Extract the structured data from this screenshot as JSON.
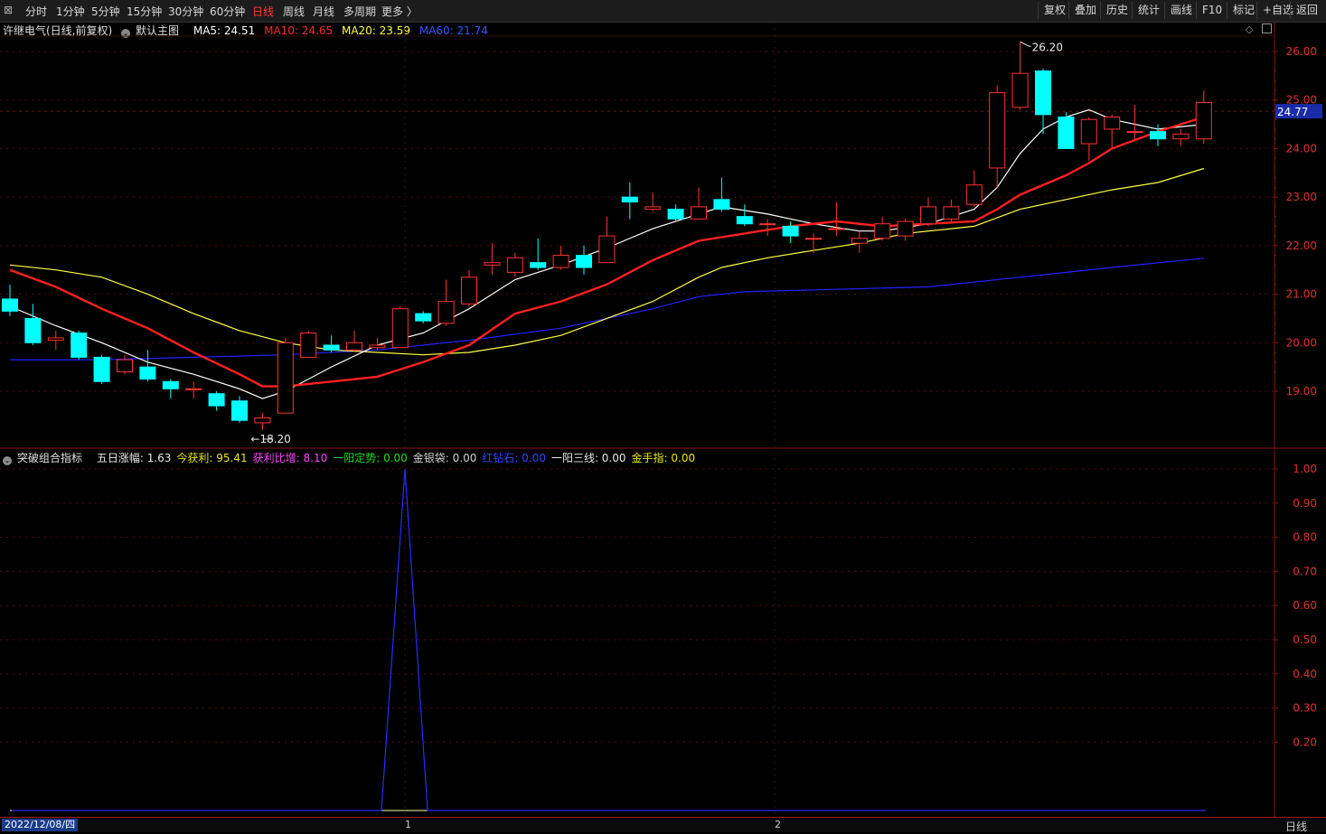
{
  "toolbar": {
    "periods": [
      "分时",
      "1分钟",
      "5分钟",
      "15分钟",
      "30分钟",
      "60分钟",
      "日线",
      "周线",
      "月线",
      "多周期",
      "更多 〉"
    ],
    "active_period": "日线",
    "right_buttons": [
      "复权",
      "叠加",
      "历史",
      "统计",
      "画线",
      "F10",
      "标记",
      "+自选",
      "返回"
    ]
  },
  "main_legend": {
    "stock": "许继电气(日线,前复权)",
    "template": "默认主图",
    "ma5": "MA5: 24.51",
    "ma10": "MA10: 24.65",
    "ma20": "MA20: 23.59",
    "ma60": "MA60: 21.74"
  },
  "sub_legend": {
    "name": "突破组合指标",
    "items": [
      {
        "label": "五日涨幅: 1.63",
        "color": "#e8e8e8"
      },
      {
        "label": "今获利: 95.41",
        "color": "#e8e800"
      },
      {
        "label": "获利比增: 8.10",
        "color": "#ff44ff"
      },
      {
        "label": "一阳定势: 0.00",
        "color": "#22dd22"
      },
      {
        "label": "金银袋: 0.00",
        "color": "#cfcfcf"
      },
      {
        "label": "红钻石: 0.00",
        "color": "#3344ff"
      },
      {
        "label": "一阳三线: 0.00",
        "color": "#e8e8e8"
      },
      {
        "label": "金手指: 0.00",
        "color": "#e8e800"
      }
    ]
  },
  "bottom": {
    "date": "2022/12/08/四",
    "marker1": "1",
    "marker2": "2",
    "period": "日线"
  },
  "colors": {
    "up": "#ff3232",
    "down": "#00ffff",
    "ma5": "#ffffff",
    "ma10": "#ff2020",
    "ma20": "#ffff44",
    "ma60": "#2222ff",
    "signal": "#2a2aff"
  },
  "chart_data": [
    {
      "type": "candlestick",
      "title": "许继电气(日线,前复权)",
      "y_ticks": [
        "26.00",
        "25.00",
        "24.00",
        "23.00",
        "22.00",
        "21.00",
        "20.00",
        "19.00"
      ],
      "ylim": [
        18.2,
        26.8
      ],
      "current_price": "24.77",
      "max_label": "26.20",
      "min_label": "18.20",
      "candles": [
        {
          "o": 20.9,
          "c": 20.65,
          "h": 21.2,
          "l": 20.55
        },
        {
          "o": 20.5,
          "c": 20.0,
          "h": 20.8,
          "l": 19.95
        },
        {
          "o": 20.05,
          "c": 20.1,
          "h": 20.25,
          "l": 19.85
        },
        {
          "o": 20.2,
          "c": 19.7,
          "h": 20.25,
          "l": 19.65
        },
        {
          "o": 19.7,
          "c": 19.2,
          "h": 19.75,
          "l": 19.15
        },
        {
          "o": 19.4,
          "c": 19.65,
          "h": 19.75,
          "l": 19.35
        },
        {
          "o": 19.5,
          "c": 19.25,
          "h": 19.85,
          "l": 19.2
        },
        {
          "o": 19.2,
          "c": 19.05,
          "h": 19.25,
          "l": 18.85
        },
        {
          "o": 19.05,
          "c": 19.05,
          "h": 19.2,
          "l": 18.85
        },
        {
          "o": 18.95,
          "c": 18.7,
          "h": 19.0,
          "l": 18.6
        },
        {
          "o": 18.8,
          "c": 18.4,
          "h": 18.9,
          "l": 18.35
        },
        {
          "o": 18.35,
          "c": 18.45,
          "h": 18.55,
          "l": 18.2
        },
        {
          "o": 18.55,
          "c": 20.0,
          "h": 20.1,
          "l": 18.55
        },
        {
          "o": 19.7,
          "c": 20.2,
          "h": 20.25,
          "l": 19.7
        },
        {
          "o": 19.95,
          "c": 19.85,
          "h": 20.15,
          "l": 19.8
        },
        {
          "o": 19.85,
          "c": 20.0,
          "h": 20.25,
          "l": 19.8
        },
        {
          "o": 19.9,
          "c": 19.95,
          "h": 20.1,
          "l": 19.85
        },
        {
          "o": 19.9,
          "c": 20.7,
          "h": 20.75,
          "l": 19.9
        },
        {
          "o": 20.6,
          "c": 20.45,
          "h": 20.65,
          "l": 20.4
        },
        {
          "o": 20.4,
          "c": 20.85,
          "h": 21.3,
          "l": 20.35
        },
        {
          "o": 20.8,
          "c": 21.35,
          "h": 21.5,
          "l": 20.75
        },
        {
          "o": 21.6,
          "c": 21.65,
          "h": 22.05,
          "l": 21.4
        },
        {
          "o": 21.45,
          "c": 21.75,
          "h": 21.85,
          "l": 21.35
        },
        {
          "o": 21.65,
          "c": 21.55,
          "h": 22.15,
          "l": 21.5
        },
        {
          "o": 21.55,
          "c": 21.8,
          "h": 22.0,
          "l": 21.5
        },
        {
          "o": 21.8,
          "c": 21.55,
          "h": 22.0,
          "l": 21.4
        },
        {
          "o": 21.65,
          "c": 22.2,
          "h": 22.6,
          "l": 21.65
        },
        {
          "o": 23.0,
          "c": 22.9,
          "h": 23.3,
          "l": 22.55
        },
        {
          "o": 22.75,
          "c": 22.8,
          "h": 23.1,
          "l": 22.7
        },
        {
          "o": 22.75,
          "c": 22.55,
          "h": 22.85,
          "l": 22.5
        },
        {
          "o": 22.55,
          "c": 22.8,
          "h": 23.2,
          "l": 22.55
        },
        {
          "o": 22.95,
          "c": 22.75,
          "h": 23.4,
          "l": 22.7
        },
        {
          "o": 22.6,
          "c": 22.45,
          "h": 22.85,
          "l": 22.4
        },
        {
          "o": 22.45,
          "c": 22.45,
          "h": 22.55,
          "l": 22.2
        },
        {
          "o": 22.4,
          "c": 22.2,
          "h": 22.5,
          "l": 22.05
        },
        {
          "o": 22.15,
          "c": 22.15,
          "h": 22.25,
          "l": 21.85
        },
        {
          "o": 22.35,
          "c": 22.35,
          "h": 22.9,
          "l": 22.2
        },
        {
          "o": 22.05,
          "c": 22.15,
          "h": 22.3,
          "l": 21.85
        },
        {
          "o": 22.15,
          "c": 22.45,
          "h": 22.6,
          "l": 22.1
        },
        {
          "o": 22.2,
          "c": 22.5,
          "h": 22.55,
          "l": 22.1
        },
        {
          "o": 22.45,
          "c": 22.8,
          "h": 23.0,
          "l": 22.4
        },
        {
          "o": 22.55,
          "c": 22.8,
          "h": 22.95,
          "l": 22.5
        },
        {
          "o": 22.85,
          "c": 23.25,
          "h": 23.55,
          "l": 22.8
        },
        {
          "o": 23.6,
          "c": 25.15,
          "h": 25.3,
          "l": 23.2
        },
        {
          "o": 24.85,
          "c": 25.55,
          "h": 26.2,
          "l": 24.8
        },
        {
          "o": 25.6,
          "c": 24.7,
          "h": 25.65,
          "l": 24.3
        },
        {
          "o": 24.65,
          "c": 24.0,
          "h": 24.75,
          "l": 24.0
        },
        {
          "o": 24.1,
          "c": 24.6,
          "h": 24.65,
          "l": 23.75
        },
        {
          "o": 24.4,
          "c": 24.65,
          "h": 24.7,
          "l": 24.0
        },
        {
          "o": 24.35,
          "c": 24.35,
          "h": 24.9,
          "l": 24.2
        },
        {
          "o": 24.35,
          "c": 24.2,
          "h": 24.5,
          "l": 24.05
        },
        {
          "o": 24.2,
          "c": 24.3,
          "h": 24.4,
          "l": 24.05
        },
        {
          "o": 24.2,
          "c": 24.95,
          "h": 25.2,
          "l": 24.1
        }
      ],
      "ma5": [
        [
          0,
          20.75
        ],
        [
          2,
          20.35
        ],
        [
          4,
          20.0
        ],
        [
          6,
          19.6
        ],
        [
          8,
          19.35
        ],
        [
          10,
          19.05
        ],
        [
          11,
          18.85
        ],
        [
          12,
          19.0
        ],
        [
          14,
          19.5
        ],
        [
          16,
          19.95
        ],
        [
          18,
          20.2
        ],
        [
          20,
          20.7
        ],
        [
          22,
          21.3
        ],
        [
          24,
          21.6
        ],
        [
          26,
          21.95
        ],
        [
          28,
          22.35
        ],
        [
          30,
          22.65
        ],
        [
          31,
          22.8
        ],
        [
          33,
          22.65
        ],
        [
          35,
          22.45
        ],
        [
          37,
          22.3
        ],
        [
          38,
          22.3
        ],
        [
          40,
          22.45
        ],
        [
          42,
          22.75
        ],
        [
          43,
          23.2
        ],
        [
          44,
          23.9
        ],
        [
          45,
          24.4
        ],
        [
          46,
          24.65
        ],
        [
          47,
          24.8
        ],
        [
          48,
          24.6
        ],
        [
          50,
          24.4
        ],
        [
          52,
          24.5
        ]
      ],
      "ma10": [
        [
          0,
          21.5
        ],
        [
          2,
          21.15
        ],
        [
          4,
          20.7
        ],
        [
          6,
          20.3
        ],
        [
          8,
          19.8
        ],
        [
          10,
          19.35
        ],
        [
          11,
          19.1
        ],
        [
          12,
          19.1
        ],
        [
          14,
          19.2
        ],
        [
          16,
          19.3
        ],
        [
          18,
          19.6
        ],
        [
          20,
          19.95
        ],
        [
          22,
          20.6
        ],
        [
          24,
          20.85
        ],
        [
          26,
          21.2
        ],
        [
          28,
          21.7
        ],
        [
          30,
          22.1
        ],
        [
          32,
          22.25
        ],
        [
          34,
          22.4
        ],
        [
          36,
          22.5
        ],
        [
          38,
          22.4
        ],
        [
          40,
          22.45
        ],
        [
          42,
          22.5
        ],
        [
          43,
          22.75
        ],
        [
          44,
          23.05
        ],
        [
          46,
          23.45
        ],
        [
          47,
          23.7
        ],
        [
          48,
          24.0
        ],
        [
          50,
          24.35
        ],
        [
          52,
          24.65
        ]
      ],
      "ma20": [
        [
          0,
          21.6
        ],
        [
          2,
          21.5
        ],
        [
          4,
          21.35
        ],
        [
          6,
          21.0
        ],
        [
          8,
          20.6
        ],
        [
          10,
          20.25
        ],
        [
          12,
          20.0
        ],
        [
          14,
          19.85
        ],
        [
          16,
          19.8
        ],
        [
          18,
          19.75
        ],
        [
          20,
          19.8
        ],
        [
          22,
          19.95
        ],
        [
          24,
          20.15
        ],
        [
          26,
          20.5
        ],
        [
          28,
          20.85
        ],
        [
          30,
          21.35
        ],
        [
          31,
          21.55
        ],
        [
          33,
          21.75
        ],
        [
          35,
          21.9
        ],
        [
          37,
          22.05
        ],
        [
          39,
          22.25
        ],
        [
          41,
          22.35
        ],
        [
          42,
          22.4
        ],
        [
          44,
          22.75
        ],
        [
          46,
          22.95
        ],
        [
          48,
          23.15
        ],
        [
          50,
          23.3
        ],
        [
          52,
          23.59
        ]
      ],
      "ma60": [
        [
          0,
          19.65
        ],
        [
          4,
          19.65
        ],
        [
          8,
          19.7
        ],
        [
          12,
          19.75
        ],
        [
          16,
          19.85
        ],
        [
          20,
          20.05
        ],
        [
          24,
          20.3
        ],
        [
          28,
          20.7
        ],
        [
          30,
          20.95
        ],
        [
          32,
          21.05
        ],
        [
          36,
          21.1
        ],
        [
          40,
          21.15
        ],
        [
          44,
          21.35
        ],
        [
          48,
          21.55
        ],
        [
          52,
          21.74
        ]
      ]
    },
    {
      "type": "line",
      "title": "突破组合指标",
      "y_ticks": [
        "1.00",
        "0.90",
        "0.80",
        "0.70",
        "0.60",
        "0.50",
        "0.40",
        "0.30",
        "0.20"
      ],
      "ylim": [
        0,
        1.0
      ],
      "signal": [
        [
          0,
          0
        ],
        [
          16,
          0
        ],
        [
          17,
          1.0
        ],
        [
          18,
          0
        ],
        [
          52,
          0
        ]
      ]
    }
  ]
}
